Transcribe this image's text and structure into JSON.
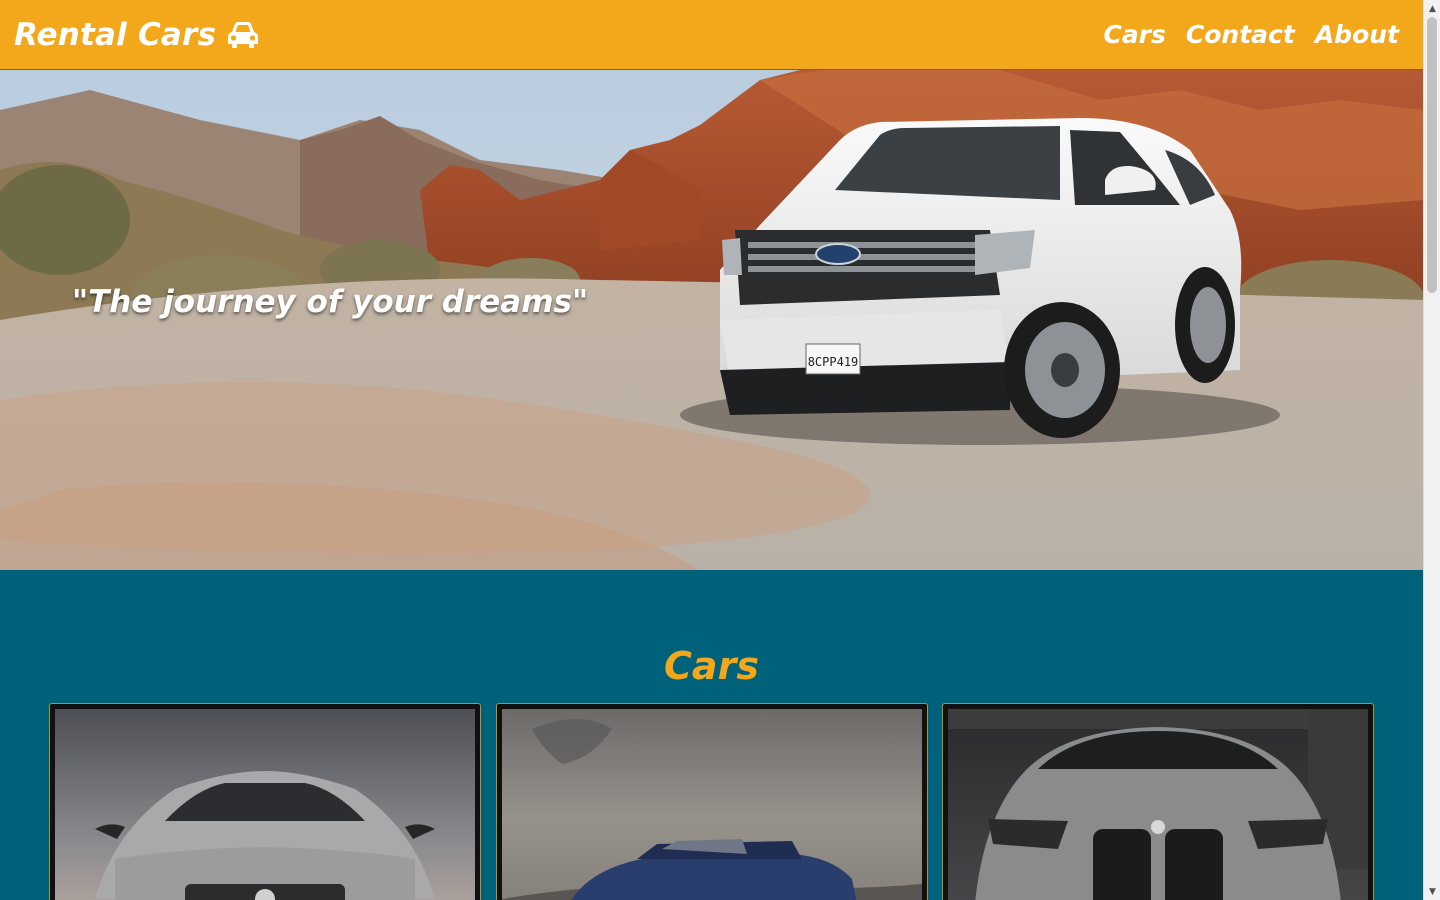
{
  "header": {
    "brand_text": "Rental Cars",
    "brand_icon": "car-icon",
    "nav": [
      "Cars",
      "Contact",
      "About"
    ]
  },
  "hero": {
    "quote": "\"The journey of your dreams\"",
    "license_plate": "8CPP419"
  },
  "cars": {
    "title": "Cars",
    "cards": [
      "silver-sedan-photo",
      "blue-pickup-photo",
      "grey-sports-sedan-photo"
    ]
  },
  "colors": {
    "accent": "#f3a81c",
    "section_bg": "#00627a",
    "header_border": "#c9411b"
  }
}
